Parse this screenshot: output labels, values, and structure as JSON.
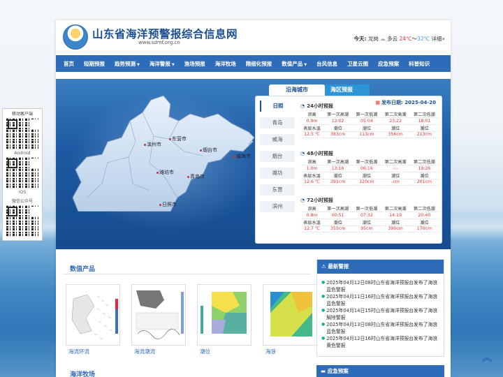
{
  "header": {
    "title": "山东省海洋预警报综合信息网",
    "url": "www.sdmf.org.cn",
    "weather": {
      "label": "今天:",
      "city": "龙岗",
      "condition": "多云",
      "temp_high": "24℃",
      "sep": "～",
      "temp_low": "32℃",
      "detail": "详细»"
    }
  },
  "nav": {
    "items": [
      {
        "label": "首页",
        "dropdown": false
      },
      {
        "label": "短期预报",
        "dropdown": false
      },
      {
        "label": "趋势预测",
        "dropdown": true
      },
      {
        "label": "海洋警报",
        "dropdown": true
      },
      {
        "label": "渔场预报",
        "dropdown": false
      },
      {
        "label": "海洋牧场",
        "dropdown": false
      },
      {
        "label": "精细化预报",
        "dropdown": false
      },
      {
        "label": "数值产品",
        "dropdown": true
      },
      {
        "label": "台风信息",
        "dropdown": false
      },
      {
        "label": "卫星云图",
        "dropdown": false
      },
      {
        "label": "应急预案",
        "dropdown": false
      },
      {
        "label": "科普知识",
        "dropdown": false
      }
    ]
  },
  "map": {
    "cities": [
      "东营市",
      "滨州市",
      "烟台市",
      "威海市",
      "潍坊市",
      "青岛市",
      "日照市"
    ]
  },
  "forecast_panel": {
    "tabs": [
      "沿海城市",
      "海区预报"
    ],
    "active_tab": "沿海城市",
    "cities": [
      "日照",
      "青岛",
      "威海",
      "烟台",
      "潍坊",
      "东营",
      "滨州"
    ],
    "active_city": "日照",
    "pub_label": "发布日期:",
    "pub_date": "2025-04-20",
    "headers": [
      "浪高",
      "第一次高潮",
      "第一次低潮",
      "第二次高潮",
      "第二次低潮"
    ],
    "headers2": [
      "表层水温",
      "潮位",
      "潮位",
      "潮位",
      "潮位"
    ],
    "blocks": [
      {
        "title": "24小时预报",
        "row1": [
          "0.9m",
          "12:02",
          "05:04",
          "23:22",
          "18:01"
        ],
        "row2": [
          "12.5 ℃",
          "383cm",
          "113cm",
          "356cm",
          "213cm"
        ]
      },
      {
        "title": "48小时预报",
        "row1": [
          "1.0m",
          "13:16",
          "06:16",
          "-:-",
          "19:26"
        ],
        "row2": [
          "12.6 ℃",
          "391cm",
          "120cm",
          "-cm",
          "201cm"
        ]
      },
      {
        "title": "72小时预报",
        "row1": [
          "0.8m",
          "00:51",
          "07:32",
          "14:19",
          "20:40"
        ],
        "row2": [
          "12.7 ℃",
          "355cm",
          "95cm",
          "390cm",
          "170cm"
        ]
      }
    ]
  },
  "products": {
    "title": "数值产品",
    "items": [
      "海流环流",
      "海流潮流",
      "潮位",
      "海浪"
    ]
  },
  "ranch": {
    "title": "海洋牧场"
  },
  "alerts": {
    "title": "最新警报",
    "items": [
      "2025年04月12日08时山东省海洋预报台发布了海浪蓝色警报",
      "2025年04月11日16时山东省海洋预报台发布了海浪蓝色警报",
      "2025年04月14日15时山东省海洋预报台发布了海浪解除警报",
      "2025年04月13日08时山东省海洋预报台发布了海浪蓝色警报",
      "2025年04月12日16时山东省海洋预报台发布了海浪黄色警报"
    ]
  },
  "emergency": {
    "title": "应急预案"
  },
  "qr": {
    "title": "移动客户端",
    "android": "Android",
    "ios": "IOS",
    "wechat": "微信公众号"
  }
}
